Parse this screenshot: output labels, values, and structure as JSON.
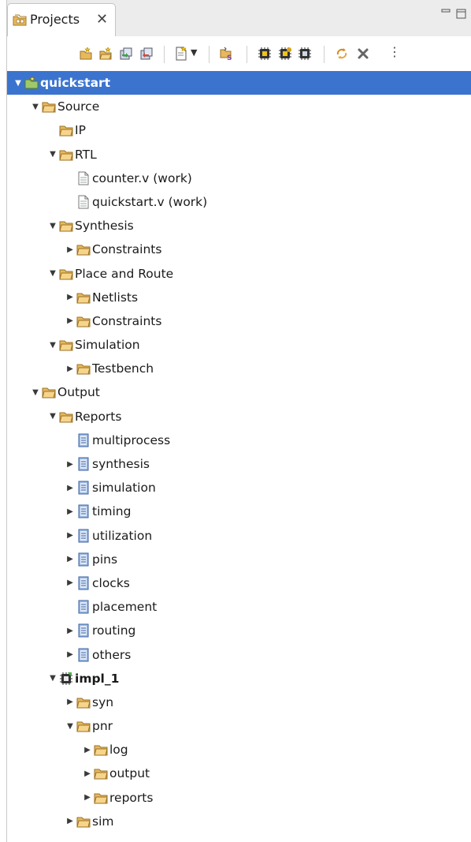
{
  "tab": {
    "label": "Projects",
    "close": "✕"
  },
  "toolbar": {
    "icons": [
      "add-file-icon",
      "add-folder-icon",
      "import-icon",
      "export-icon",
      "new-file-dropdown-icon",
      "script-icon",
      "chip-run-icon",
      "chip-step-icon",
      "chip-save-icon",
      "refresh-icon",
      "delete-icon",
      "more-icon"
    ],
    "dropdown_glyph": "▼",
    "more_glyph": "⋮"
  },
  "colors": {
    "selection": "#3b74cf",
    "folder": "#e6b65a",
    "report": "#5b8bd0"
  },
  "tree": [
    {
      "label": "quickstart",
      "icon": "project",
      "twisty": "open",
      "bold": true,
      "selected": true
    },
    {
      "label": "Source",
      "icon": "folder",
      "twisty": "open"
    },
    {
      "label": "IP",
      "icon": "folder",
      "twisty": "none"
    },
    {
      "label": "RTL",
      "icon": "folder",
      "twisty": "open"
    },
    {
      "label": "counter.v (work)",
      "icon": "file",
      "twisty": "none"
    },
    {
      "label": "quickstart.v (work)",
      "icon": "file",
      "twisty": "none"
    },
    {
      "label": "Synthesis",
      "icon": "folder",
      "twisty": "open"
    },
    {
      "label": "Constraints",
      "icon": "folder",
      "twisty": "closed"
    },
    {
      "label": "Place and Route",
      "icon": "folder",
      "twisty": "open"
    },
    {
      "label": "Netlists",
      "icon": "folder",
      "twisty": "closed"
    },
    {
      "label": "Constraints",
      "icon": "folder",
      "twisty": "closed"
    },
    {
      "label": "Simulation",
      "icon": "folder",
      "twisty": "open"
    },
    {
      "label": "Testbench",
      "icon": "folder",
      "twisty": "closed"
    },
    {
      "label": "Output",
      "icon": "folder",
      "twisty": "open"
    },
    {
      "label": "Reports",
      "icon": "folder",
      "twisty": "open"
    },
    {
      "label": "multiprocess",
      "icon": "report",
      "twisty": "none"
    },
    {
      "label": "synthesis",
      "icon": "report",
      "twisty": "closed"
    },
    {
      "label": "simulation",
      "icon": "report",
      "twisty": "closed"
    },
    {
      "label": "timing",
      "icon": "report",
      "twisty": "closed"
    },
    {
      "label": "utilization",
      "icon": "report",
      "twisty": "closed"
    },
    {
      "label": "pins",
      "icon": "report",
      "twisty": "closed"
    },
    {
      "label": "clocks",
      "icon": "report",
      "twisty": "closed"
    },
    {
      "label": "placement",
      "icon": "report",
      "twisty": "none"
    },
    {
      "label": "routing",
      "icon": "report",
      "twisty": "closed"
    },
    {
      "label": "others",
      "icon": "report",
      "twisty": "closed"
    },
    {
      "label": "impl_1",
      "icon": "impl",
      "twisty": "open",
      "bold": true
    },
    {
      "label": "syn",
      "icon": "folder",
      "twisty": "closed"
    },
    {
      "label": "pnr",
      "icon": "folder",
      "twisty": "open"
    },
    {
      "label": "log",
      "icon": "folder",
      "twisty": "closed"
    },
    {
      "label": "output",
      "icon": "folder",
      "twisty": "closed"
    },
    {
      "label": "reports",
      "icon": "folder",
      "twisty": "closed"
    },
    {
      "label": "sim",
      "icon": "folder",
      "twisty": "closed"
    }
  ]
}
